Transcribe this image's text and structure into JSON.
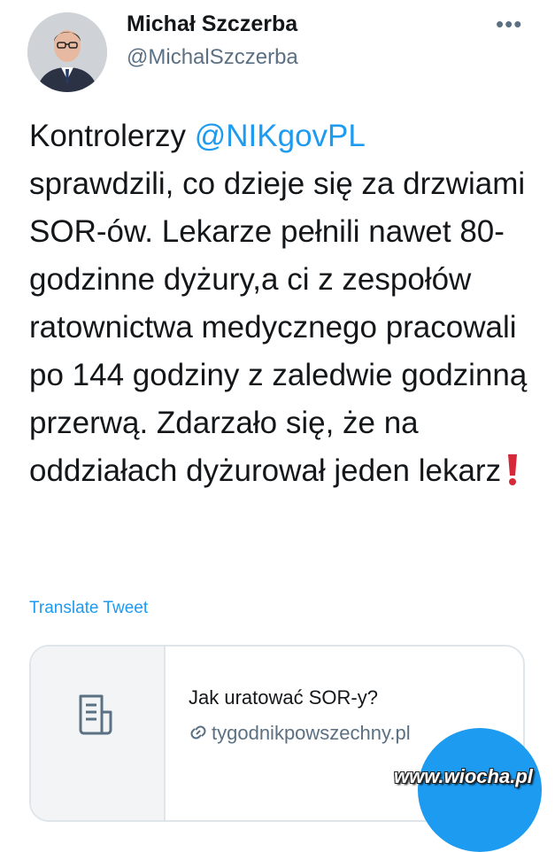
{
  "author": {
    "name": "Michał Szczerba",
    "handle": "@MichalSzczerba"
  },
  "more_menu_icon": "more-horizontal-icon",
  "tweet": {
    "line1_before": "Kontrolerzy ",
    "mention": "@NIKgovPL",
    "body": "sprawdzili, co dzieje się za drzwiami SOR-ów. Lekarze pełnili nawet 80-godzinne dyżury,a ci z zespołów ratownictwa medycznego pracowali po 144 godziny z zaledwie godzinną przerwą. Zdarzało się, że na oddziałach dyżurował jeden lekarz",
    "emoji_icon": "red-exclamation-icon"
  },
  "translate_label": "Translate Tweet",
  "link_card": {
    "title": "Jak uratować SOR-y?",
    "domain": "tygodnikpowszechny.pl",
    "media_icon": "document-icon",
    "link_icon": "link-icon"
  },
  "watermark": "www.wiocha.pl",
  "colors": {
    "accent": "#1d9bf0",
    "text": "#14171a",
    "secondary": "#5b7083",
    "border": "#dfe6ea"
  }
}
